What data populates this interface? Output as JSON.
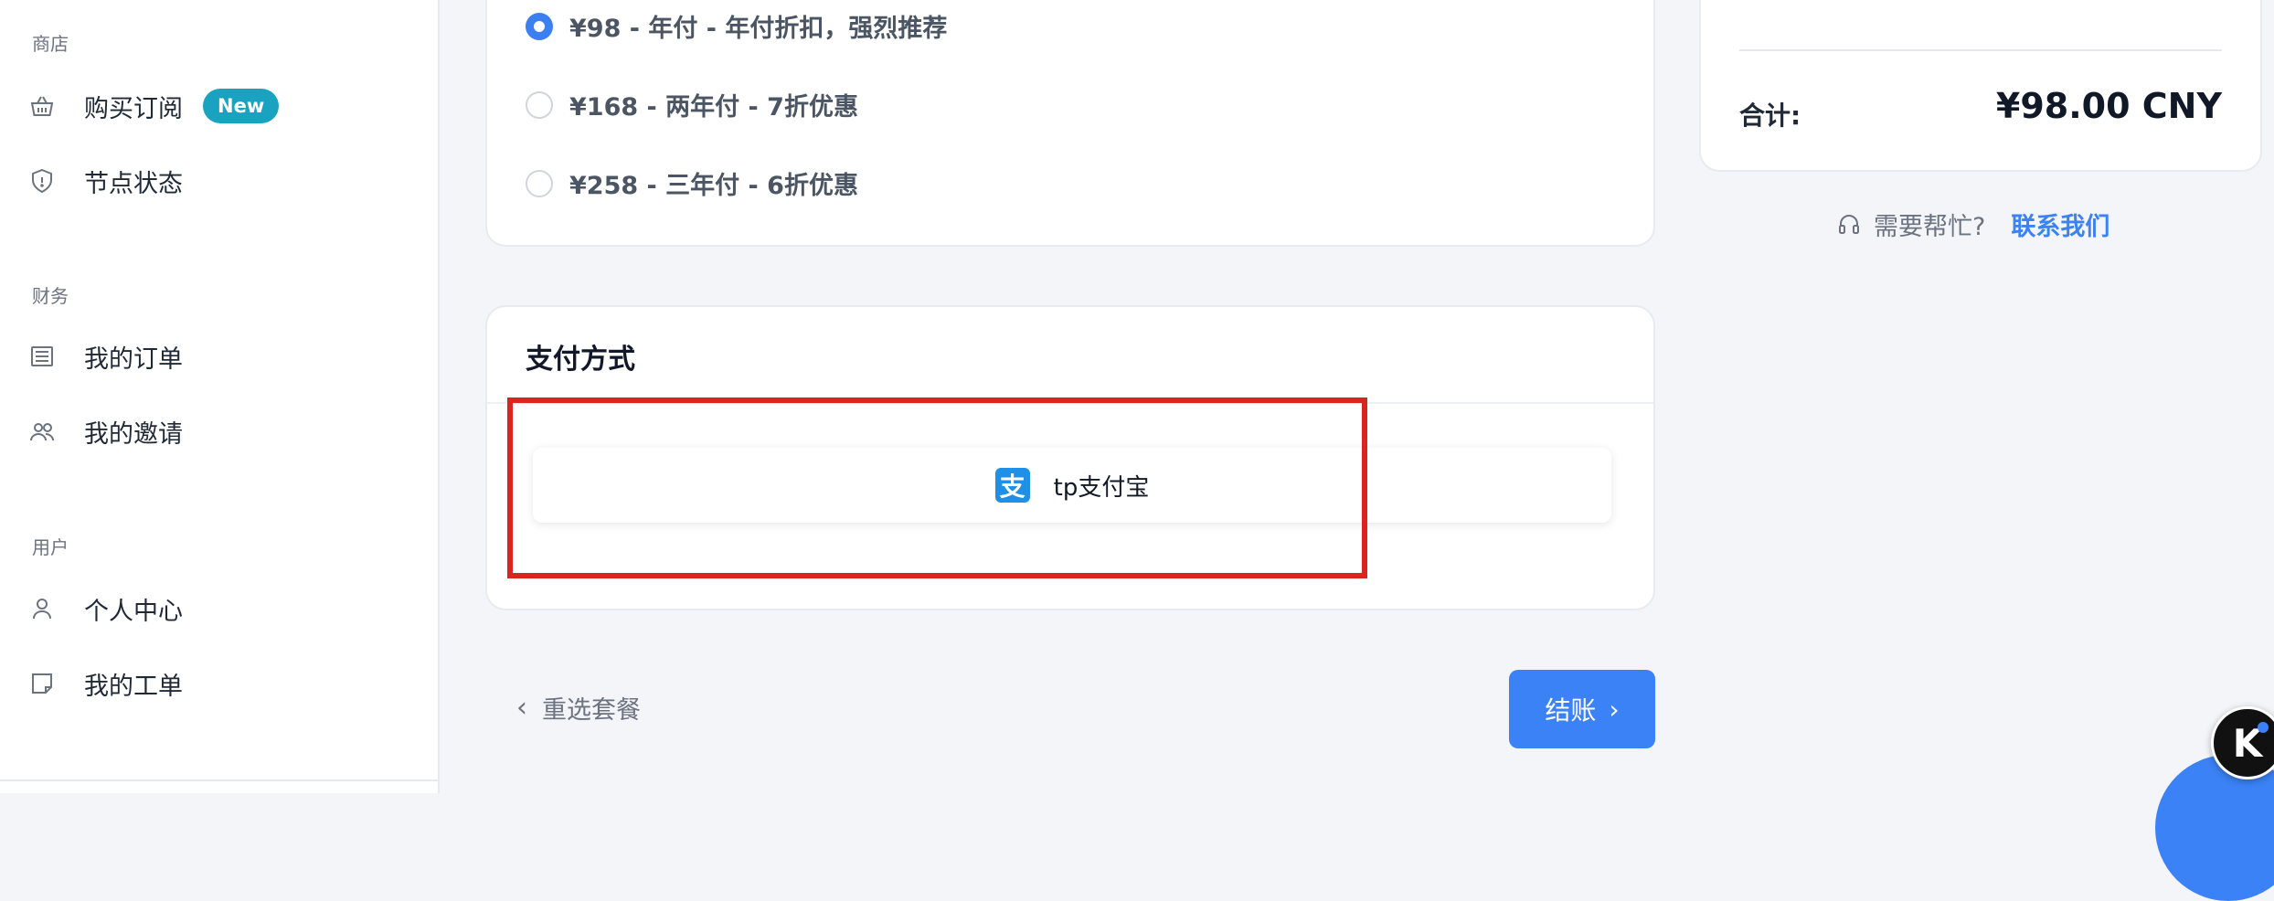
{
  "sidebar": {
    "sections": [
      {
        "label": "商店",
        "items": [
          {
            "label": "购买订阅",
            "icon": "basket-icon",
            "badge": "New"
          },
          {
            "label": "节点状态",
            "icon": "shield-icon"
          }
        ]
      },
      {
        "label": "财务",
        "items": [
          {
            "label": "我的订单",
            "icon": "list-icon"
          },
          {
            "label": "我的邀请",
            "icon": "users-icon"
          }
        ]
      },
      {
        "label": "用户",
        "items": [
          {
            "label": "个人中心",
            "icon": "user-icon"
          },
          {
            "label": "我的工单",
            "icon": "ticket-icon"
          }
        ]
      }
    ]
  },
  "plans": {
    "options": [
      {
        "label": "¥98 - 年付 - 年付折扣，强烈推荐",
        "selected": true
      },
      {
        "label": "¥168 - 两年付 - 7折优惠",
        "selected": false
      },
      {
        "label": "¥258 - 三年付 - 6折优惠",
        "selected": false
      }
    ]
  },
  "payment": {
    "title": "支付方式",
    "options": [
      {
        "label": "tp支付宝",
        "icon": "alipay-icon"
      }
    ]
  },
  "actions": {
    "back_label": "重选套餐",
    "checkout_label": "结账"
  },
  "summary": {
    "total_label": "合计:",
    "total_value": "¥98.00 CNY"
  },
  "help": {
    "text": "需要帮忙?",
    "link": "联系我们"
  },
  "widget": {
    "logo_letter": "K"
  },
  "colors": {
    "accent": "#3b82f6",
    "badge": "#1aa3c0",
    "highlight": "#d9251d"
  }
}
